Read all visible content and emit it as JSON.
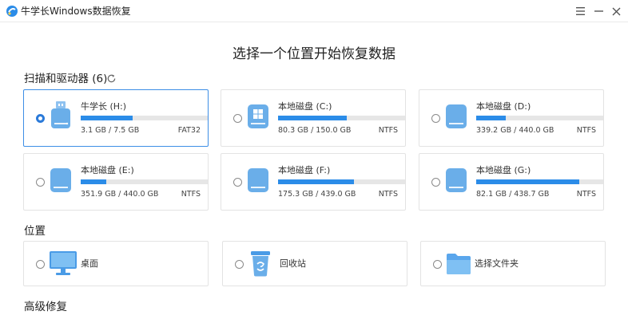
{
  "window": {
    "title": "牛学长Windows数据恢复",
    "controls": [
      "menu-icon",
      "minimize-icon",
      "close-icon"
    ]
  },
  "heading": "选择一个位置开始恢复数据",
  "drives_section": {
    "label": "扫描和驱动器 (6)",
    "refresh_icon": "refresh-icon"
  },
  "drives": [
    {
      "name": "牛学长 (H:)",
      "size": "3.1 GB / 7.5 GB",
      "fs": "FAT32",
      "used_fraction": 0.41,
      "selected": true,
      "icon": "usb-drive-icon"
    },
    {
      "name": "本地磁盘 (C:)",
      "size": "80.3 GB / 150.0 GB",
      "fs": "NTFS",
      "used_fraction": 0.54,
      "selected": false,
      "icon": "windows-drive-icon"
    },
    {
      "name": "本地磁盘 (D:)",
      "size": "339.2 GB / 440.0 GB",
      "fs": "NTFS",
      "used_fraction": 0.23,
      "selected": false,
      "icon": "hard-drive-icon"
    },
    {
      "name": "本地磁盘 (E:)",
      "size": "351.9 GB / 440.0 GB",
      "fs": "NTFS",
      "used_fraction": 0.2,
      "selected": false,
      "icon": "hard-drive-icon"
    },
    {
      "name": "本地磁盘 (F:)",
      "size": "175.3 GB / 439.0 GB",
      "fs": "NTFS",
      "used_fraction": 0.6,
      "selected": false,
      "icon": "hard-drive-icon"
    },
    {
      "name": "本地磁盘 (G:)",
      "size": "82.1 GB / 438.7 GB",
      "fs": "NTFS",
      "used_fraction": 0.81,
      "selected": false,
      "icon": "hard-drive-icon"
    }
  ],
  "location_section": {
    "label": "位置"
  },
  "locations": [
    {
      "label": "桌面",
      "icon": "monitor-icon"
    },
    {
      "label": "回收站",
      "icon": "recycle-bin-icon"
    },
    {
      "label": "选择文件夹",
      "icon": "folder-icon"
    }
  ],
  "advanced_section": {
    "label": "高级修复"
  },
  "colors": {
    "accent": "#2b8ce8",
    "selected_border": "#3d8ee6",
    "bar_track": "#e6e6e6",
    "icon_blue": "#6aaee9"
  }
}
